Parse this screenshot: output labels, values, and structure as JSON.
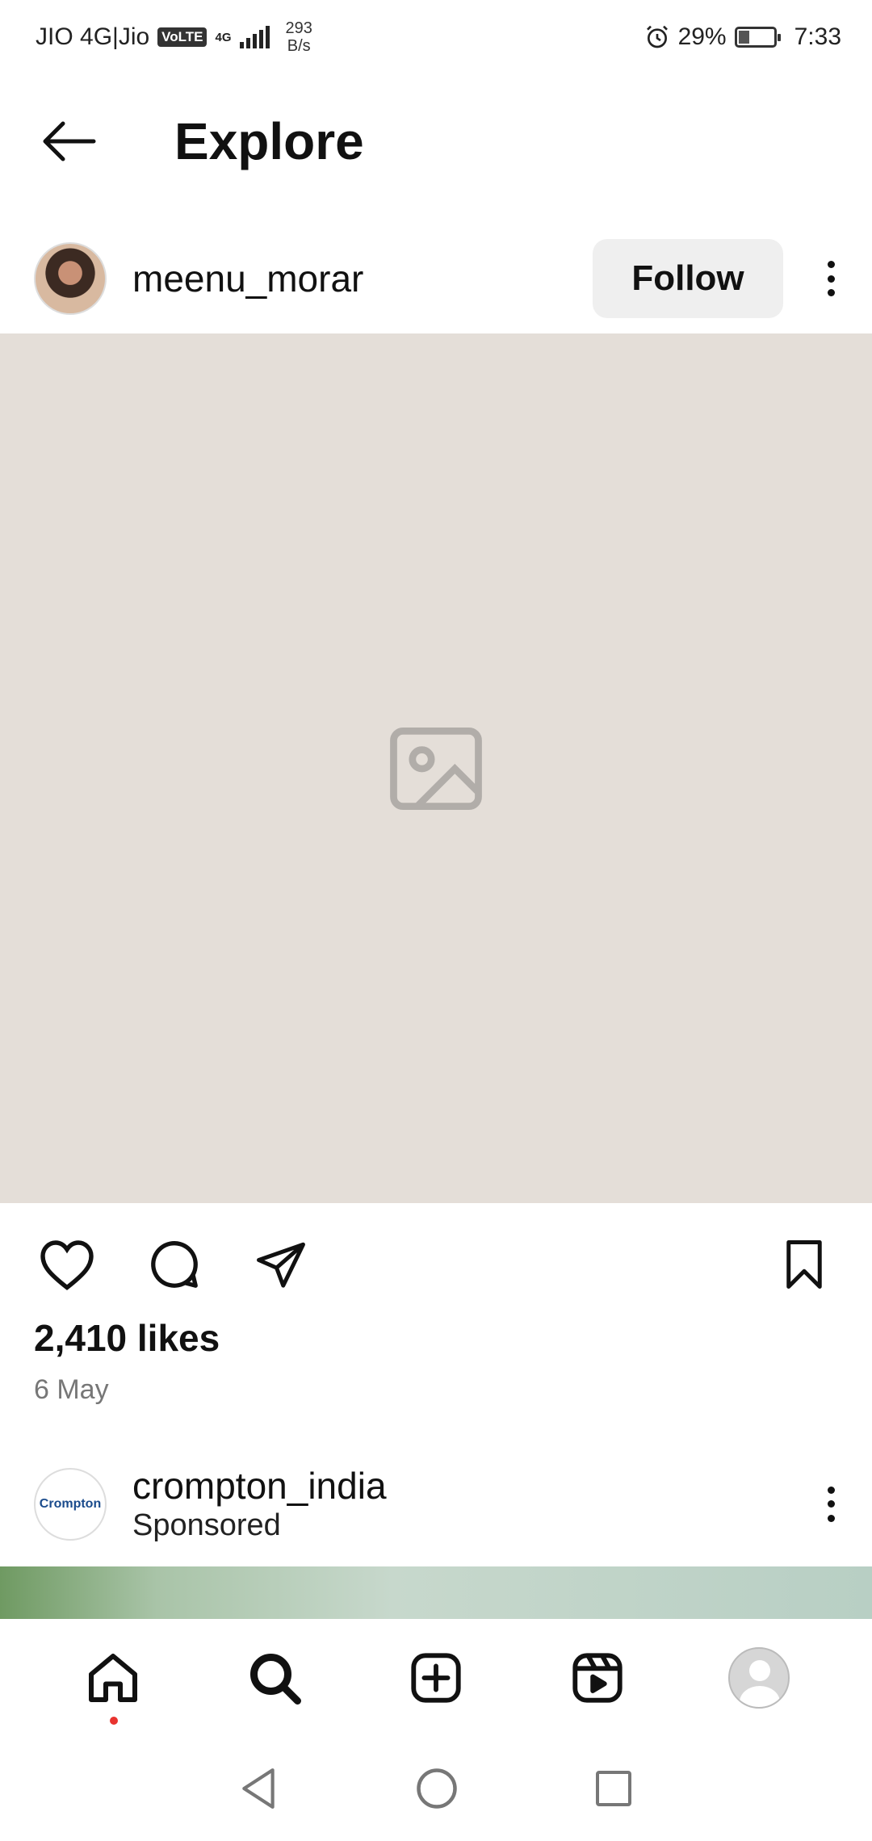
{
  "status_bar": {
    "carrier": "JIO 4G|Jio",
    "volte": "VoLTE",
    "net_type": "4G",
    "speed_value": "293",
    "speed_unit": "B/s",
    "battery_percent": "29%",
    "battery_level": 0.29,
    "time": "7:33"
  },
  "header": {
    "title": "Explore",
    "back_icon": "arrow-left-icon"
  },
  "post": {
    "username": "meenu_morar",
    "follow_label": "Follow",
    "likes": "2,410 likes",
    "date": "6 May",
    "actions": [
      "heart-icon",
      "comment-icon",
      "share-icon",
      "bookmark-icon"
    ]
  },
  "sponsored": {
    "brand_name": "crompton_india",
    "label": "Sponsored",
    "avatar_text": "Crompton"
  },
  "bottom_nav": {
    "items": [
      "home-icon",
      "search-icon",
      "create-icon",
      "reels-icon",
      "profile-icon"
    ],
    "notification_color": "#e8332f"
  },
  "system_nav": [
    "back-triangle-icon",
    "home-circle-icon",
    "recents-square-icon"
  ]
}
